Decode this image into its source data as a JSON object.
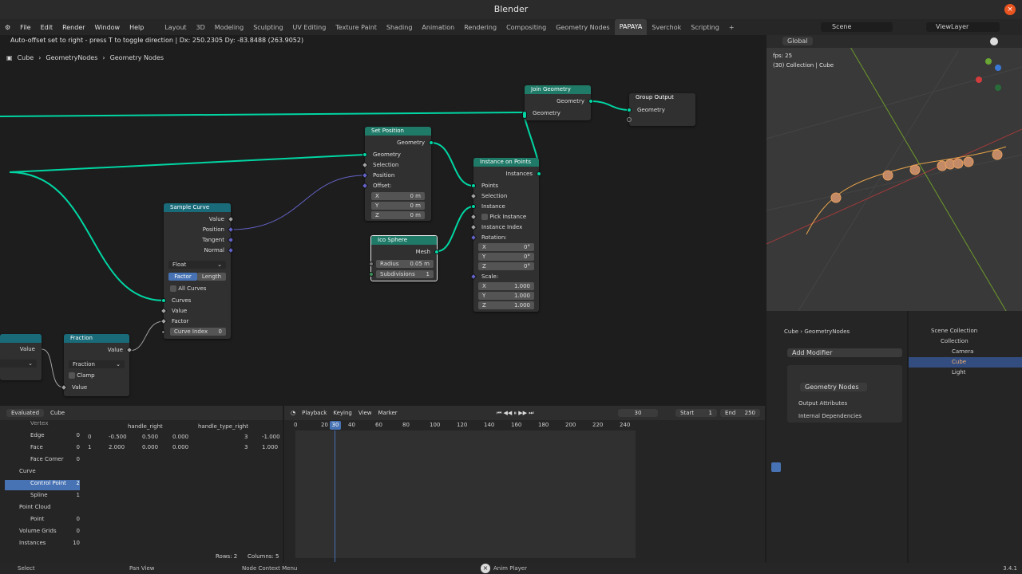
{
  "window": {
    "title": "Blender",
    "close": "×"
  },
  "menu": {
    "items": [
      "File",
      "Edit",
      "Render",
      "Window",
      "Help"
    ]
  },
  "workspaces": [
    "Layout",
    "3D",
    "Modeling",
    "Sculpting",
    "UV Editing",
    "Texture Paint",
    "Shading",
    "Animation",
    "Rendering",
    "Compositing",
    "Geometry Nodes",
    "PAPAYA",
    "Sverchok",
    "Scripting",
    "+"
  ],
  "scene": {
    "name": "Scene",
    "view_layer": "ViewLayer"
  },
  "status_header": "Auto-offset set to right - press T to toggle direction | Dx: 250.2305   Dy: -83.8488 (263.9052)",
  "breadcrumb": [
    "Cube",
    "GeometryNodes",
    "Geometry Nodes"
  ],
  "nodes": {
    "join": {
      "title": "Join Geometry",
      "out": "Geometry",
      "in": "Geometry"
    },
    "group_output": {
      "title": "Group Output",
      "in": "Geometry"
    },
    "set_position": {
      "title": "Set Position",
      "out": "Geometry",
      "in_geo": "Geometry",
      "sel": "Selection",
      "pos": "Position",
      "off": "Offset:",
      "x": "X",
      "xv": "0 m",
      "y": "Y",
      "yv": "0 m",
      "z": "Z",
      "zv": "0 m"
    },
    "instance": {
      "title": "Instance on Points",
      "out": "Instances",
      "points": "Points",
      "sel": "Selection",
      "inst": "Instance",
      "pick": "Pick Instance",
      "idx": "Instance Index",
      "rot": "Rotation:",
      "rx": "X",
      "rxv": "0°",
      "ry": "Y",
      "ryv": "0°",
      "rz": "Z",
      "rzv": "0°",
      "scale": "Scale:",
      "sx": "X",
      "sxv": "1.000",
      "sy": "Y",
      "syv": "1.000",
      "sz": "Z",
      "szv": "1.000"
    },
    "sample": {
      "title": "Sample Curve",
      "value": "Value",
      "position": "Position",
      "tangent": "Tangent",
      "normal": "Normal",
      "mode": "Float",
      "factor": "Factor",
      "length": "Length",
      "all": "All Curves",
      "curves": "Curves",
      "in_value": "Value",
      "in_factor": "Factor",
      "curve_index": "Curve Index",
      "curve_index_v": "0"
    },
    "ico": {
      "title": "Ico Sphere",
      "mesh": "Mesh",
      "radius": "Radius",
      "radius_v": "0.05 m",
      "subdiv": "Subdivisions",
      "subdiv_v": "1"
    },
    "fraction": {
      "title": "Fraction",
      "value": "Value",
      "mode": "Fraction",
      "clamp": "Clamp",
      "in_value": "Value"
    },
    "left_node": {
      "value": "Value"
    }
  },
  "viewport": {
    "global": "Global",
    "fps": "fps: 25",
    "collection": "(30) Collection | Cube"
  },
  "properties": {
    "obj": "Cube",
    "mod": "GeometryNodes",
    "add": "Add Modifier",
    "gn": "Geometry Nodes",
    "output_attr": "Output Attributes",
    "internal": "Internal Dependencies"
  },
  "outliner": {
    "scene": "Scene Collection",
    "collection": "Collection",
    "items": [
      "Camera",
      "Cube",
      "Light"
    ]
  },
  "spreadsheet": {
    "mode": "Evaluated",
    "object": "Cube",
    "cols": [
      "handle_right",
      "handle_type_right"
    ],
    "rows": [
      [
        "0",
        "-0.500",
        "0.500",
        "0.000",
        "3",
        "-1.000"
      ],
      [
        "1",
        "2.000",
        "0.000",
        "0.000",
        "3",
        "1.000"
      ]
    ],
    "tree": [
      [
        "Vertex",
        ""
      ],
      [
        "Edge",
        "0"
      ],
      [
        "Face",
        "0"
      ],
      [
        "Face Corner",
        "0"
      ],
      [
        "Curve",
        ""
      ],
      [
        "Control Point",
        "2"
      ],
      [
        "Spline",
        "1"
      ],
      [
        "Point Cloud",
        ""
      ],
      [
        "Point",
        "0"
      ],
      [
        "Volume Grids",
        "0"
      ],
      [
        "Instances",
        "10"
      ]
    ],
    "rows_count": "Rows: 2",
    "cols_count": "Columns: 5"
  },
  "timeline": {
    "playback": "Playback",
    "keying": "Keying",
    "view": "View",
    "marker": "Marker",
    "frame": "30",
    "start_label": "Start",
    "start": "1",
    "end_label": "End",
    "end": "250",
    "ticks": [
      "0",
      "20",
      "40",
      "60",
      "80",
      "100",
      "120",
      "140",
      "160",
      "180",
      "200",
      "220",
      "240"
    ],
    "current": "30"
  },
  "statusbar": {
    "select": "Select",
    "pan": "Pan View",
    "ctx": "Node Context Menu",
    "anim": "Anim Player",
    "version": "3.4.1"
  },
  "colors": {
    "geo_header": "#1f7a68",
    "geo_socket": "#00d6a3",
    "curve_header": "#1a6b7a",
    "input_header": "#82543a",
    "selection": "#4772b3"
  }
}
